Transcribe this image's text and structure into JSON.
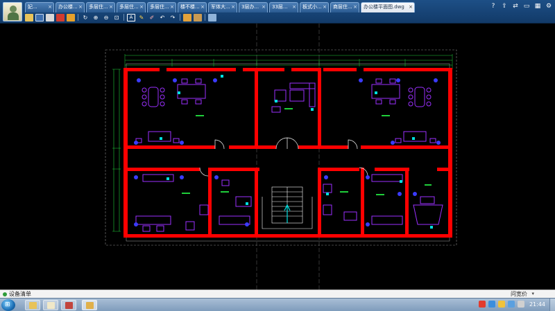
{
  "app": {
    "active_file": "办公楼平面图.dwg"
  },
  "tabs": [
    {
      "label": "妃..."
    },
    {
      "label": "办公楼..."
    },
    {
      "label": "多层住..."
    },
    {
      "label": "多层住..."
    },
    {
      "label": "多层住..."
    },
    {
      "label": "楼不楼..."
    },
    {
      "label": "军体大..."
    },
    {
      "label": "3层办..."
    },
    {
      "label": "33层..."
    },
    {
      "label": "板式小..."
    },
    {
      "label": "商层住..."
    },
    {
      "label": "办公楼平面图.dwg",
      "active": true
    }
  ],
  "window_controls": [
    "help-icon",
    "share-icon",
    "swap-icon",
    "restore-icon",
    "tile-icon",
    "settings-icon"
  ],
  "toolbar": [
    "open-icon",
    "save-icon",
    "print-icon",
    "pdf-icon",
    "lock-icon",
    "rotate-icon",
    "zoom-in-icon",
    "zoom-out-icon",
    "pan-icon",
    "text-icon",
    "pencil-icon",
    "brush-icon",
    "undo-icon",
    "redo-icon",
    "measure-icon",
    "layers-icon",
    "compare-icon"
  ],
  "status": {
    "label": "设备清单",
    "right": "问宽价"
  },
  "taskbar": {
    "time": "21:44"
  },
  "colors": {
    "wall": "#ff0000",
    "dimension": "#1fcf3a",
    "furniture": "#9b30ff",
    "fixture": "#3b3bff",
    "accent": "#00e0e0",
    "frame": "#ffffff"
  }
}
